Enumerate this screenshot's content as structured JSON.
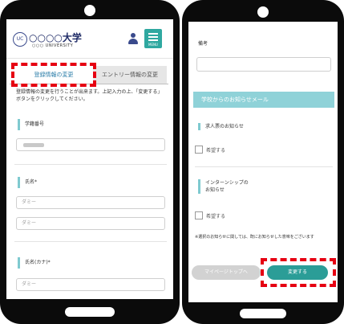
{
  "left": {
    "header": {
      "logo_mark": "UC",
      "title": "○○○○大学",
      "subtitle": "○○○ UNIVERSITY",
      "menu_label": "MENU"
    },
    "tabs": [
      {
        "label": "登録情報の変更"
      },
      {
        "label": "エントリー情報の変更"
      }
    ],
    "note": "登録情報の変更を行うことが出来ます。上記入力の上、「変更する」ボタンをクリックしてください。",
    "fields": {
      "student_number_label": "学籍番号",
      "name_label": "氏名*",
      "surname_placeholder": "ダミー",
      "given_name_placeholder": "ダミー",
      "name_kana_label": "氏名(カナ)*",
      "kana_placeholder": "ダミー"
    }
  },
  "right": {
    "top_label": "備考",
    "section_title": "学校からのお知らせメール",
    "items": [
      {
        "label": "求人票のお知らせ",
        "checkbox_label": "希望する"
      },
      {
        "label": "インターンシップの\nお知らせ",
        "checkbox_label": "希望する"
      }
    ],
    "footnote": "※選択のお知らせに関しては、既にお知らせした意味をございます",
    "back_label": "マイページトップへ",
    "submit_label": "変更する"
  },
  "colors": {
    "accent": "#2b9d97",
    "section": "#8fd2d8",
    "highlight": "#e60012"
  }
}
